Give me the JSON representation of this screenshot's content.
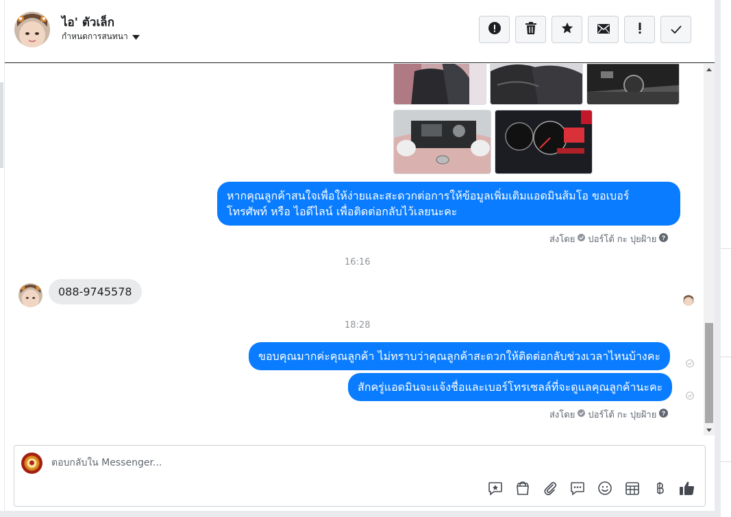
{
  "header": {
    "contact_name": "ไอ' ตัวเล็ก",
    "assign_label": "กำหนดการสนทนา",
    "actions": [
      {
        "name": "spam-button",
        "icon": "exclamation-circle-icon"
      },
      {
        "name": "delete-button",
        "icon": "trash-icon"
      },
      {
        "name": "star-button",
        "icon": "star-icon"
      },
      {
        "name": "mark-unread-button",
        "icon": "envelope-icon"
      },
      {
        "name": "follow-up-button",
        "icon": "exclamation-icon"
      },
      {
        "name": "mark-done-button",
        "icon": "check-icon"
      }
    ]
  },
  "thread": {
    "out_message_1": "หากคุณลูกค้าสนใจเพื่อให้ง่ายและสะดวกต่อการให้ข้อมูลเพิ่มเติมแอดมินส้มโอ ขอเบอร์ โทรศัพท์ หรือ ไอดีไลน์ เพื่อติดต่อกลับไว้เลยนะคะ",
    "sent_by_label": "ส่งโดย",
    "sender_name": "ปอร์โต้ กะ ปุยฝ้าย",
    "time_1": "16:16",
    "in_message_1": "088-9745578",
    "time_2": "18:28",
    "out_message_2": "ขอบคุณมากค่ะคุณลูกค้า ไม่ทราบว่าคุณลูกค้าสะดวกให้ติดต่อกลับช่วงเวลาไหนบ้างคะ",
    "out_message_3": "สักครู่แอดมินจะแจ้งชื่อและเบอร์โทรเซลล์ที่จะดูแลคุณลูกค้านะคะ"
  },
  "composer": {
    "placeholder": "ตอบกลับใน Messenger...",
    "tools": [
      "saved-reply-icon",
      "shop-bag-icon",
      "paperclip-icon",
      "chat-bubbles-icon",
      "smiley-icon",
      "calendar-grid-icon",
      "baht-icon",
      "thumbs-up-icon"
    ]
  },
  "colors": {
    "outgoing_bubble": "#0a7cff",
    "incoming_bubble": "#e9eaeb"
  }
}
